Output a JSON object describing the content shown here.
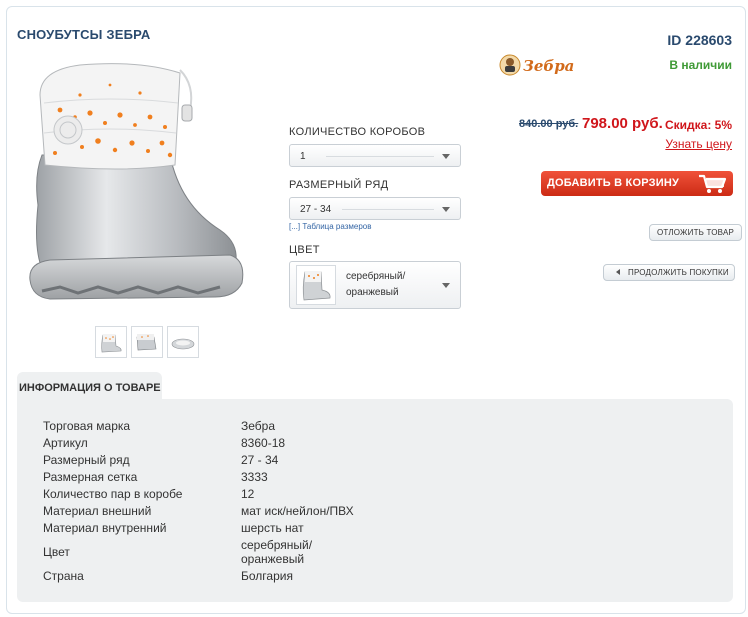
{
  "product": {
    "title": "СНОУБУТСЫ ЗЕБРА",
    "id": "ID 228603",
    "brand_logo_text": "Зебра",
    "stock": "В наличии"
  },
  "options": {
    "boxes_label": "КОЛИЧЕСТВО КОРОБОВ",
    "boxes_value": "1",
    "size_label": "РАЗМЕРНЫЙ РЯД",
    "size_value": "27 - 34",
    "size_table_link": "[...] Таблица размеров",
    "color_label": "ЦВЕТ",
    "color_value_line1": "серебряный/",
    "color_value_line2": "оранжевый"
  },
  "pricing": {
    "old_price": "840.00 руб.",
    "new_price": "798.00 руб.",
    "discount": "Скидка: 5%",
    "know_price": "Узнать цену"
  },
  "actions": {
    "add_to_cart": "ДОБАВИТЬ В КОРЗИНУ",
    "postpone": "ОТЛОЖИТЬ ТОВАР",
    "continue": "ПРОДОЛЖИТЬ ПОКУПКИ"
  },
  "info": {
    "tab_label": "ИНФОРМАЦИЯ О ТОВАРЕ",
    "rows": [
      {
        "label": "Торговая марка",
        "value": "Зебра"
      },
      {
        "label": "Артикул",
        "value": "8360-18"
      },
      {
        "label": "Размерный ряд",
        "value": "27 - 34"
      },
      {
        "label": "Размерная сетка",
        "value": "3333"
      },
      {
        "label": "Количество пар в коробе",
        "value": "12"
      },
      {
        "label": "Материал внешний",
        "value": "мат иск/нейлон/ПВХ"
      },
      {
        "label": "Материал внутренний",
        "value": "шерсть нат"
      },
      {
        "label": "Цвет",
        "value": "серебряный/",
        "value2": "оранжевый"
      },
      {
        "label": "Страна",
        "value": "Болгария"
      }
    ]
  },
  "colors": {
    "title": "#2a4a6e",
    "stock": "#3f9a36",
    "price": "#d0161b",
    "cart_button": "#e4412a",
    "panel": "#eef0f1"
  },
  "icons": {
    "cart": "cart-icon",
    "back": "triangle-left-icon",
    "dropdown": "chevron-down-icon"
  }
}
